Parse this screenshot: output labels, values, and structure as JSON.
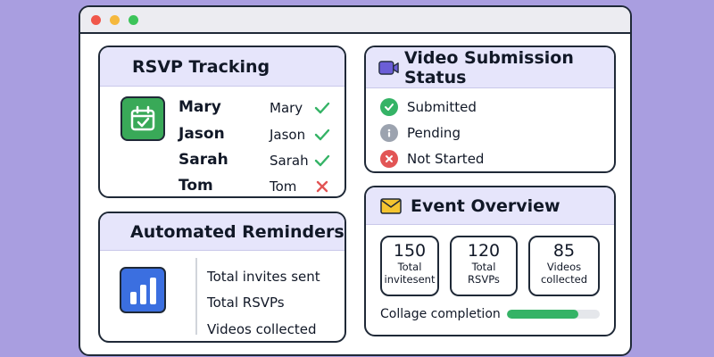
{
  "window": {
    "controls": [
      "close",
      "minimize",
      "maximize"
    ],
    "control_colors": [
      "#f0564a",
      "#f5b83d",
      "#3cc45a"
    ]
  },
  "rsvp": {
    "title": "RSVP Tracking",
    "icon": "calendar-check-icon",
    "rows": [
      {
        "name": "Mary",
        "name2": "Mary",
        "status": "check"
      },
      {
        "name": "Jason",
        "name2": "Jason",
        "status": "check"
      },
      {
        "name": "Sarah",
        "name2": "Sarah",
        "status": "check"
      },
      {
        "name": "Tom",
        "name2": "Tom",
        "status": "cross"
      }
    ]
  },
  "reminders": {
    "title": "Automated Reminders",
    "icon": "bar-chart-icon",
    "items": [
      "Total invites sent",
      "Total RSVPs",
      "Videos collected"
    ]
  },
  "video": {
    "title": "Video Submission Status",
    "icon": "video-camera-icon",
    "statuses": [
      {
        "label": "Submitted",
        "icon": "check-circle-icon",
        "color": "#35b366"
      },
      {
        "label": "Pending",
        "icon": "info-circle-icon",
        "color": "#9ca3af"
      },
      {
        "label": "Not Started",
        "icon": "x-circle-icon",
        "color": "#e25555"
      }
    ]
  },
  "event": {
    "title": "Event Overview",
    "icon": "envelope-icon",
    "stats": [
      {
        "value": "150",
        "label_line1": "Total",
        "label_line2": "invitesent"
      },
      {
        "value": "120",
        "label_line1": "Total",
        "label_line2": "RSVPs"
      },
      {
        "value": "85",
        "label_line1": "Videos",
        "label_line2": "collected"
      }
    ],
    "collage_label": "Collage completion",
    "collage_progress": 0.77
  },
  "colors": {
    "background": "#a99ee0",
    "card_header": "#e6e5fb",
    "accent_green": "#35b366",
    "accent_red": "#e25555",
    "accent_blue": "#3b6fe0",
    "accent_purple": "#6b5ed6"
  }
}
